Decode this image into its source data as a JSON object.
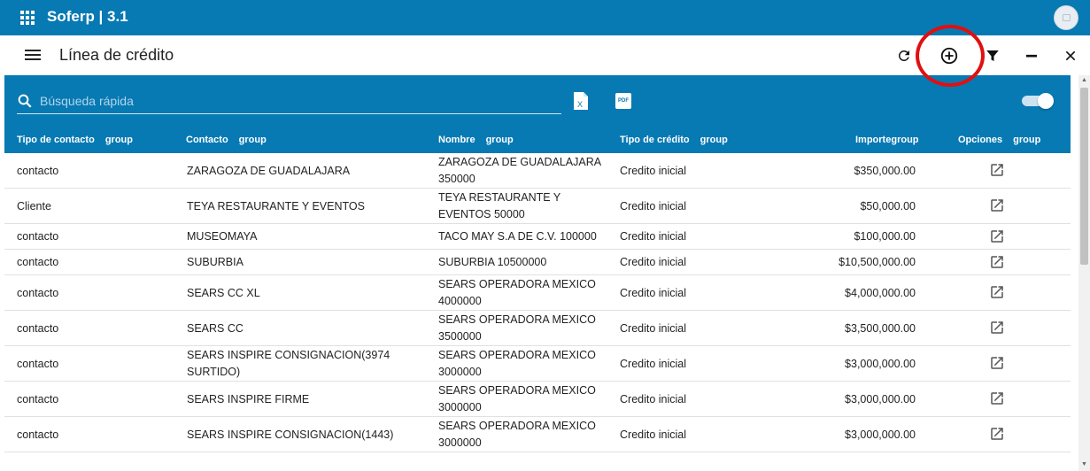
{
  "app": {
    "title": "Soferp | 3.1"
  },
  "header": {
    "title": "Línea de crédito"
  },
  "toolbar": {
    "icons": [
      "refresh-icon",
      "add-circle-icon",
      "filter-icon",
      "minimize-icon",
      "close-icon"
    ],
    "highlight_color": "#e01010"
  },
  "search": {
    "placeholder": "Búsqueda rápida",
    "value": ""
  },
  "colors": {
    "primary": "#0779b3",
    "highlight": "#e01010"
  },
  "columns": [
    {
      "label": "Tipo de contacto",
      "group": "group"
    },
    {
      "label": "Contacto",
      "group": "group"
    },
    {
      "label": "Nombre",
      "group": "group"
    },
    {
      "label": "Tipo de crédito",
      "group": "group"
    },
    {
      "label": "Importe",
      "group": "group"
    },
    {
      "label": "Opciones",
      "group": "group"
    }
  ],
  "rows": [
    {
      "tipo": "contacto",
      "contacto": "ZARAGOZA DE GUADALAJARA",
      "nombre": "ZARAGOZA DE GUADALAJARA 350000",
      "credito": "Credito inicial",
      "importe": "$350,000.00"
    },
    {
      "tipo": "Cliente",
      "contacto": "TEYA RESTAURANTE Y EVENTOS",
      "nombre": "TEYA RESTAURANTE Y EVENTOS 50000",
      "credito": "Credito inicial",
      "importe": "$50,000.00"
    },
    {
      "tipo": "contacto",
      "contacto": "MUSEOMAYA",
      "nombre": "TACO MAY S.A DE C.V. 100000",
      "credito": "Credito inicial",
      "importe": "$100,000.00"
    },
    {
      "tipo": "contacto",
      "contacto": "SUBURBIA",
      "nombre": "SUBURBIA 10500000",
      "credito": "Credito inicial",
      "importe": "$10,500,000.00"
    },
    {
      "tipo": "contacto",
      "contacto": "SEARS CC XL",
      "nombre": "SEARS OPERADORA MEXICO 4000000",
      "credito": "Credito inicial",
      "importe": "$4,000,000.00"
    },
    {
      "tipo": "contacto",
      "contacto": "SEARS CC",
      "nombre": "SEARS OPERADORA MEXICO 3500000",
      "credito": "Credito inicial",
      "importe": "$3,500,000.00"
    },
    {
      "tipo": "contacto",
      "contacto": "SEARS INSPIRE CONSIGNACION(3974 SURTIDO)",
      "nombre": "SEARS OPERADORA MEXICO 3000000",
      "credito": "Credito inicial",
      "importe": "$3,000,000.00"
    },
    {
      "tipo": "contacto",
      "contacto": "SEARS INSPIRE FIRME",
      "nombre": "SEARS OPERADORA MEXICO 3000000",
      "credito": "Credito inicial",
      "importe": "$3,000,000.00"
    },
    {
      "tipo": "contacto",
      "contacto": "SEARS INSPIRE CONSIGNACION(1443)",
      "nombre": "SEARS OPERADORA MEXICO 3000000",
      "credito": "Credito inicial",
      "importe": "$3,000,000.00"
    }
  ]
}
